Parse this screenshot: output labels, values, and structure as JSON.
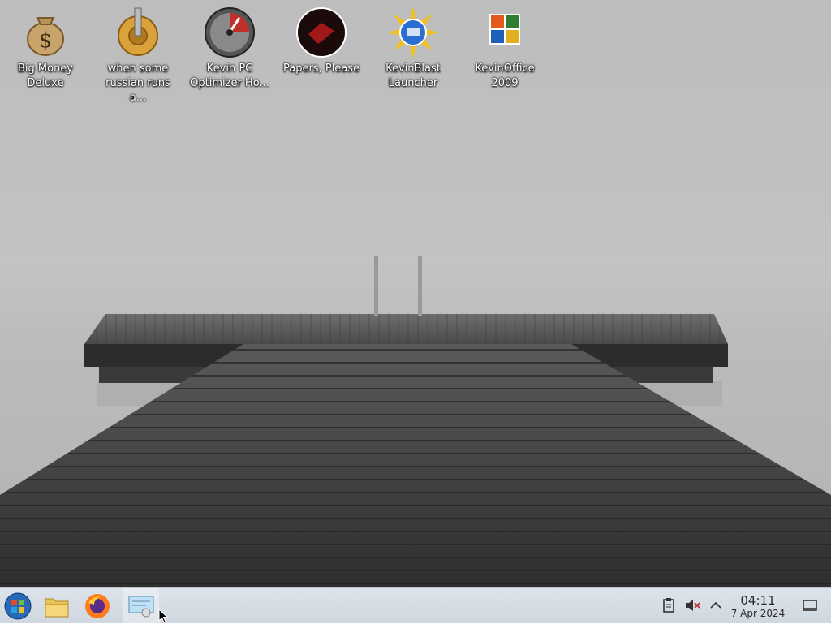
{
  "desktop": {
    "icons": [
      {
        "label": "Big Money\nDeluxe",
        "icon": "money-bag-icon"
      },
      {
        "label": "when some\nrussian runs a...",
        "icon": "gear-icon"
      },
      {
        "label": "Kevin PC\nOptimizer Ho...",
        "icon": "speedometer-icon"
      },
      {
        "label": "Papers, Please",
        "icon": "emblem-icon"
      },
      {
        "label": "KevinBlast\nLauncher",
        "icon": "sun-globe-icon"
      },
      {
        "label": "KevinOffice\n2009",
        "icon": "office-logo-icon"
      }
    ]
  },
  "taskbar": {
    "start_icon": "start-orb-icon",
    "pinned": [
      "file-manager-icon",
      "firefox-icon",
      "settings-app-icon"
    ],
    "tray": [
      "clipboard-icon",
      "volume-muted-icon",
      "chevron-up-icon"
    ],
    "time": "04:11",
    "date": "7 Apr 2024",
    "show_desktop_icon": "show-desktop-icon"
  }
}
